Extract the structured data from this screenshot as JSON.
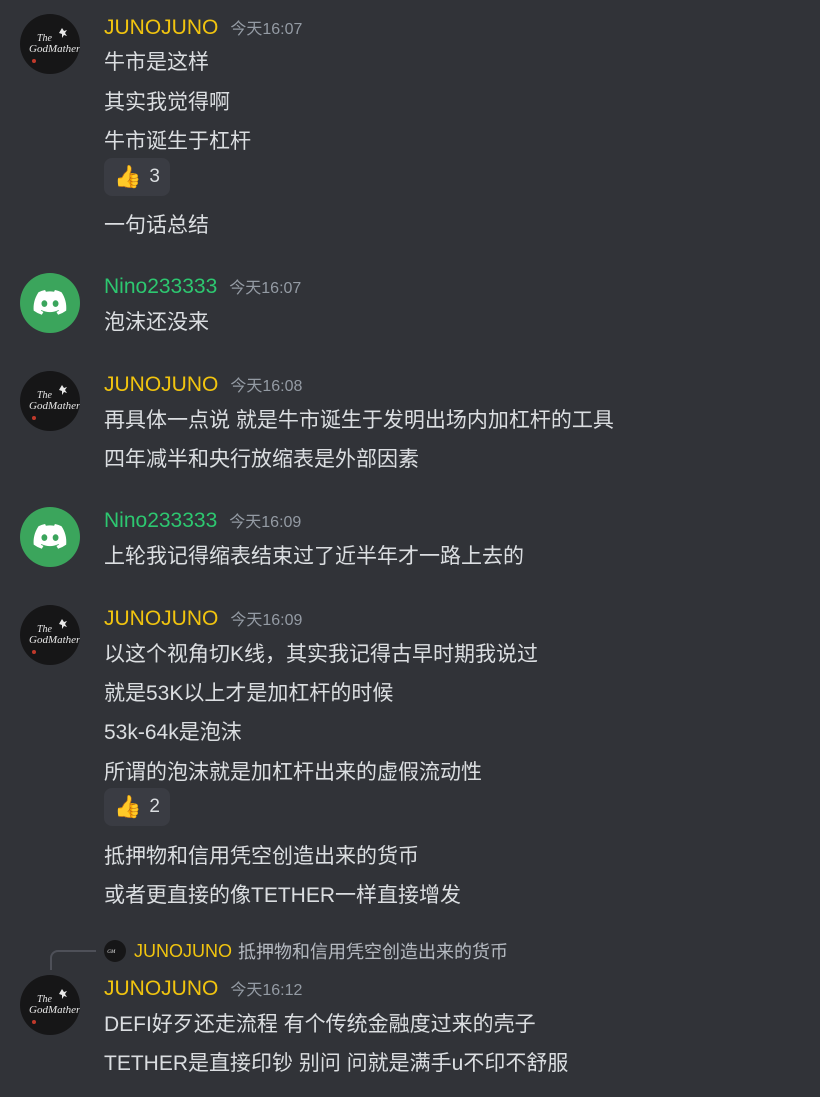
{
  "colors": {
    "background": "#313338",
    "username_yellow": "#f1c40f",
    "username_green": "#2dc770",
    "text": "#dbdee1",
    "muted": "#949ba4",
    "discord_green": "#3ba55c"
  },
  "messages": [
    {
      "author": "JUNOJUNO",
      "time": "今天16:07",
      "avatar_icon": "godfather-avatar",
      "lines": [
        "牛市是这样",
        "其实我觉得啊",
        "牛市诞生于杠杆"
      ],
      "reaction": {
        "icon": "thumbs-up-icon",
        "emoji": "👍",
        "count": "3"
      },
      "after_lines": [
        "一句话总结"
      ]
    },
    {
      "author": "Nino233333",
      "time": "今天16:07",
      "avatar_icon": "discord-logo-icon",
      "lines": [
        "泡沫还没来"
      ]
    },
    {
      "author": "JUNOJUNO",
      "time": "今天16:08",
      "avatar_icon": "godfather-avatar",
      "lines": [
        "再具体一点说 就是牛市诞生于发明出场内加杠杆的工具",
        "四年减半和央行放缩表是外部因素"
      ]
    },
    {
      "author": "Nino233333",
      "time": "今天16:09",
      "avatar_icon": "discord-logo-icon",
      "lines": [
        "上轮我记得缩表结束过了近半年才一路上去的"
      ]
    },
    {
      "author": "JUNOJUNO",
      "time": "今天16:09",
      "avatar_icon": "godfather-avatar",
      "lines": [
        "以这个视角切K线，其实我记得古早时期我说过",
        "就是53K以上才是加杠杆的时候",
        "53k-64k是泡沫",
        "所谓的泡沫就是加杠杆出来的虚假流动性"
      ],
      "reaction": {
        "icon": "thumbs-up-icon",
        "emoji": "👍",
        "count": "2"
      },
      "after_lines": [
        "抵押物和信用凭空创造出来的货币",
        "或者更直接的像TETHER一样直接增发"
      ]
    },
    {
      "author": "JUNOJUNO",
      "time": "今天16:12",
      "avatar_icon": "godfather-avatar",
      "reply_to": {
        "author": "JUNOJUNO",
        "text": "抵押物和信用凭空创造出来的货币"
      },
      "lines": [
        "DEFI好歹还走流程 有个传统金融度过来的壳子",
        "TETHER是直接印钞 别问 问就是满手u不印不舒服"
      ]
    }
  ]
}
